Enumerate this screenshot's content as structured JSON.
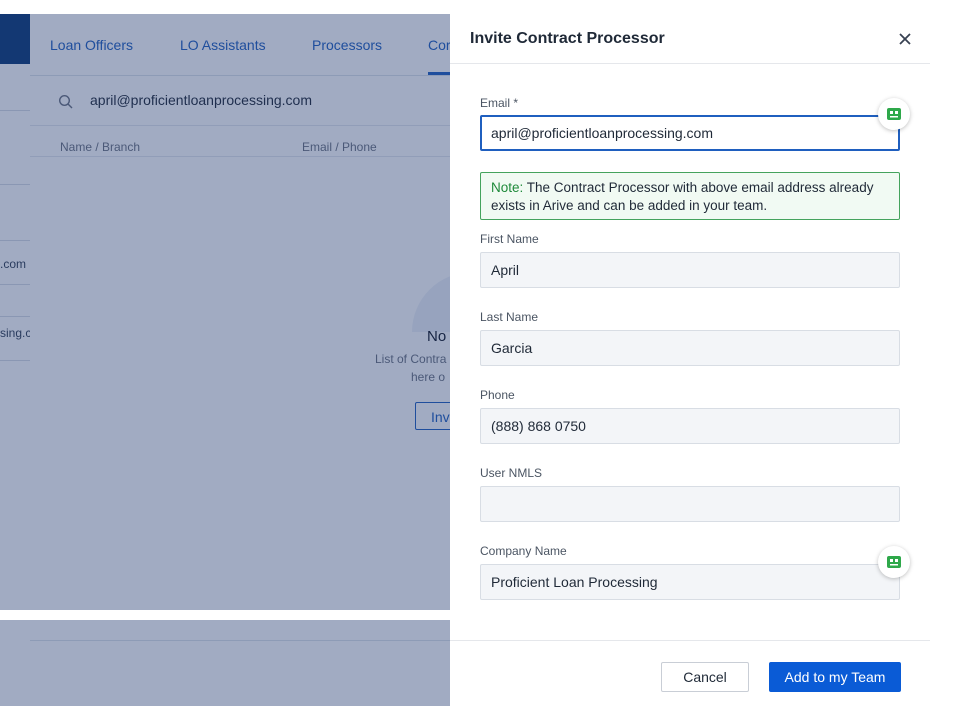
{
  "tabs": [
    {
      "label": "Loan Officers"
    },
    {
      "label": "LO Assistants"
    },
    {
      "label": "Processors"
    },
    {
      "label": "Cor"
    }
  ],
  "search": {
    "value": "april@proficientloanprocessing.com"
  },
  "table": {
    "columns": [
      "Name / Branch",
      "Email / Phone"
    ]
  },
  "sidebar_fragments": [
    ".com",
    "sing.c"
  ],
  "empty_state": {
    "title": "No",
    "desc_line1": "List of Contra",
    "desc_line2": "here o",
    "button": "Inv"
  },
  "modal": {
    "title": "Invite Contract Processor",
    "close_icon": "close-icon",
    "fields": {
      "email": {
        "label": "Email *",
        "value": "april@proficientloanprocessing.com"
      },
      "first_name": {
        "label": "First Name",
        "value": "April"
      },
      "last_name": {
        "label": "Last Name",
        "value": "Garcia"
      },
      "phone": {
        "label": "Phone",
        "value": "(888) 868 0750"
      },
      "user_nmls": {
        "label": "User NMLS",
        "value": ""
      },
      "company_name": {
        "label": "Company Name",
        "value": "Proficient Loan Processing"
      }
    },
    "note": {
      "label": "Note:",
      "text": " The Contract Processor with above email address already exists in Arive and can be added in your team."
    },
    "footer": {
      "cancel_label": "Cancel",
      "primary_label": "Add to my Team"
    }
  },
  "colors": {
    "primary": "#0a5bd6",
    "link": "#1f5fbf",
    "note_border": "#45a35d",
    "note_label": "#1e8a3a",
    "extension_icon": "#2ea84a"
  }
}
